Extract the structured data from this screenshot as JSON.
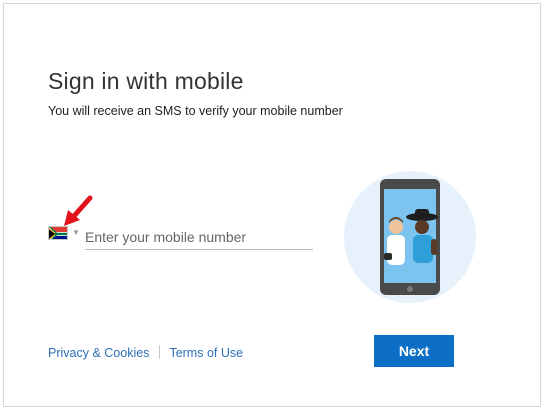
{
  "signin": {
    "title": "Sign in with mobile",
    "subtitle": "You will receive an SMS to verify your mobile number"
  },
  "phone": {
    "country_flag": "south-africa-flag",
    "placeholder": "Enter your mobile number",
    "value": ""
  },
  "footer": {
    "privacy_label": "Privacy & Cookies",
    "terms_label": "Terms of Use"
  },
  "actions": {
    "next_label": "Next"
  },
  "colors": {
    "accent": "#0C6FC5",
    "link": "#2F6FB5",
    "annotation_arrow": "#E3121B"
  }
}
